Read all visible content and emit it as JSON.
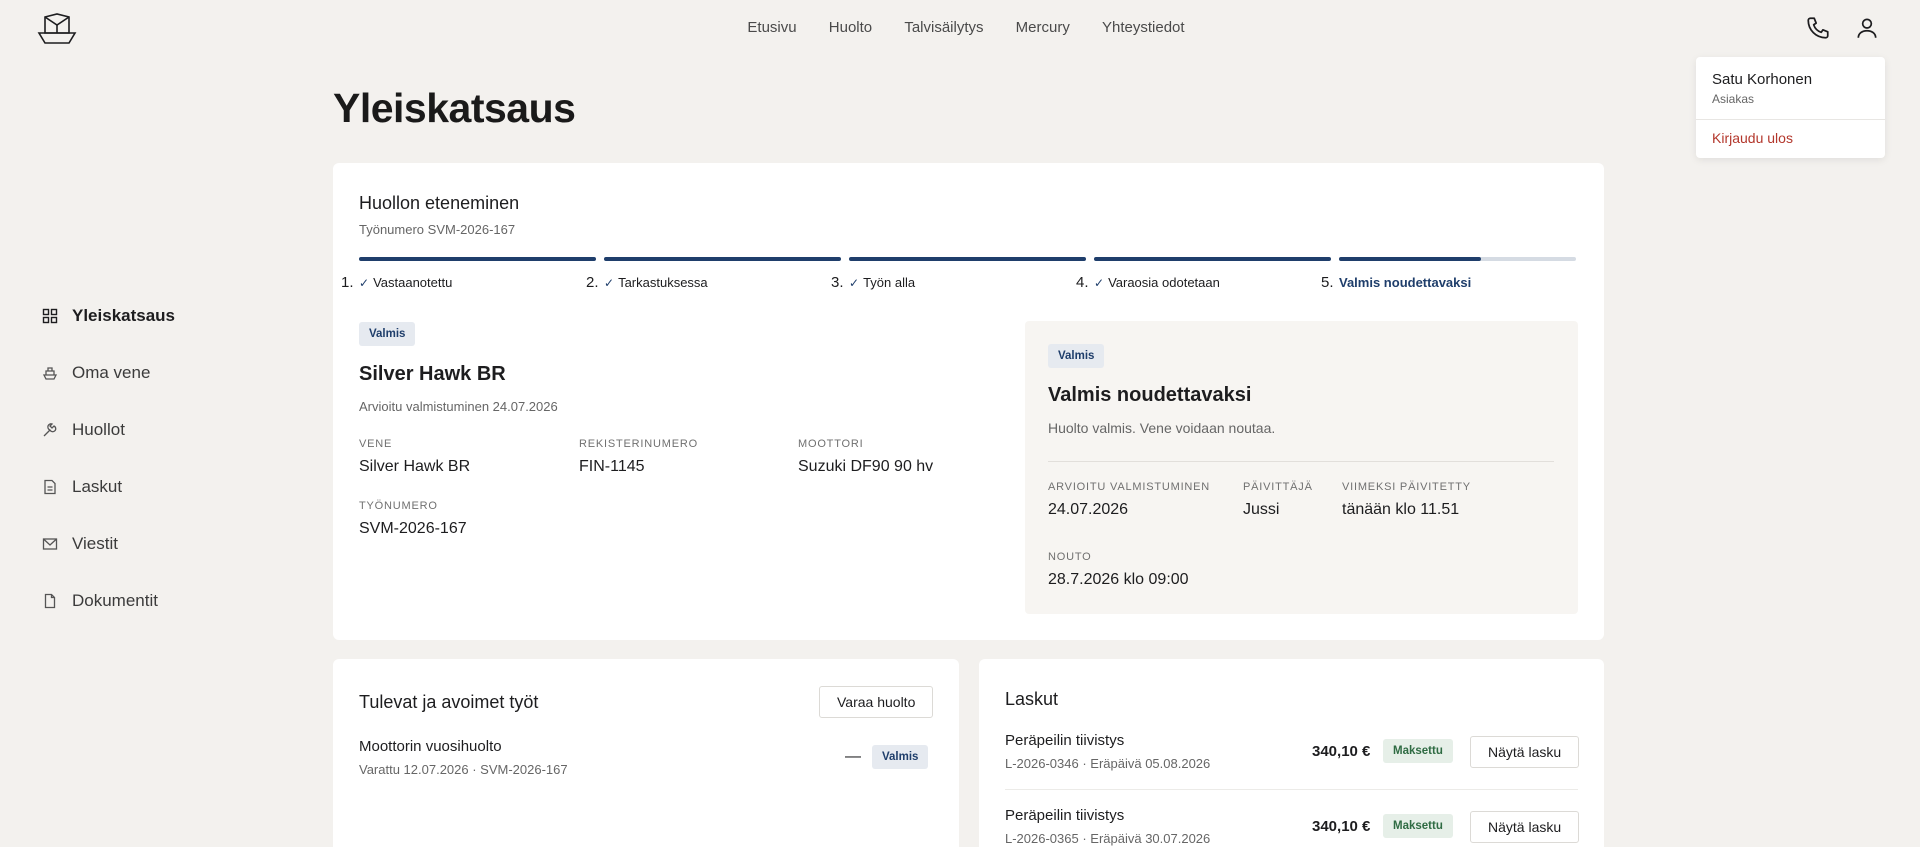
{
  "nav": [
    "Etusivu",
    "Huolto",
    "Talvisäilytys",
    "Mercury",
    "Yhteystiedot"
  ],
  "user_menu": {
    "name": "Satu Korhonen",
    "role": "Asiakas",
    "logout": "Kirjaudu ulos"
  },
  "sidebar": [
    {
      "label": "Yleiskatsaus",
      "icon": "grid-icon",
      "active": true
    },
    {
      "label": "Oma vene",
      "icon": "boat-icon"
    },
    {
      "label": "Huollot",
      "icon": "wrench-icon"
    },
    {
      "label": "Laskut",
      "icon": "invoice-icon"
    },
    {
      "label": "Viestit",
      "icon": "mail-icon"
    },
    {
      "label": "Dokumentit",
      "icon": "document-icon"
    }
  ],
  "page_title": "Yleiskatsaus",
  "progress": {
    "title": "Huollon eteneminen",
    "work_number": "Työnumero SVM-2026-167",
    "steps": [
      {
        "num": "1.",
        "label": "Vastaanotettu",
        "done": true
      },
      {
        "num": "2.",
        "label": "Tarkastuksessa",
        "done": true
      },
      {
        "num": "3.",
        "label": "Työn alla",
        "done": true
      },
      {
        "num": "4.",
        "label": "Varaosia odotetaan",
        "done": true
      },
      {
        "num": "5.",
        "label": "Valmis noudettavaksi",
        "done": false,
        "current": true,
        "fill_fraction": 0.6
      }
    ]
  },
  "boat": {
    "badge": "Valmis",
    "name": "Silver Hawk BR",
    "estimate": "Arvioitu valmistuminen 24.07.2026",
    "fields": {
      "vene_label": "VENE",
      "vene": "Silver Hawk BR",
      "reg_label": "REKISTERINUMERO",
      "reg": "FIN-1145",
      "motor_label": "MOOTTORI",
      "motor": "Suzuki DF90 90 hv",
      "work_label": "TYÖNUMERO",
      "work": "SVM-2026-167"
    }
  },
  "status": {
    "badge": "Valmis",
    "title": "Valmis noudettavaksi",
    "desc": "Huolto valmis. Vene voidaan noutaa.",
    "est_label": "ARVIOITU VALMISTUMINEN",
    "est": "24.07.2026",
    "updater_label": "PÄIVITTÄJÄ",
    "updater": "Jussi",
    "updated_label": "VIIMEKSI PÄIVITETTY",
    "updated": "tänään klo 11.51",
    "pickup_label": "NOUTO",
    "pickup": "28.7.2026 klo 09:00"
  },
  "jobs": {
    "title": "Tulevat ja avoimet työt",
    "book_button": "Varaa huolto",
    "items": [
      {
        "name": "Moottorin vuosihuolto",
        "meta": "Varattu 12.07.2026 · SVM-2026-167",
        "dash": "—",
        "status": "Valmis"
      }
    ]
  },
  "bills": {
    "title": "Laskut",
    "items": [
      {
        "name": "Peräpeilin tiivistys",
        "meta": "L-2026-0346 · Eräpäivä 05.08.2026",
        "amount": "340,10 €",
        "status": "Maksettu",
        "button": "Näytä lasku"
      },
      {
        "name": "Peräpeilin tiivistys",
        "meta": "L-2026-0365 · Eräpäivä 30.07.2026",
        "amount": "340,10 €",
        "status": "Maksettu",
        "button": "Näytä lasku"
      }
    ]
  },
  "colors": {
    "accent": "#1f3e6b",
    "background": "#f3f1ee",
    "logout": "#b3372c",
    "paid": "#2f6b43"
  }
}
